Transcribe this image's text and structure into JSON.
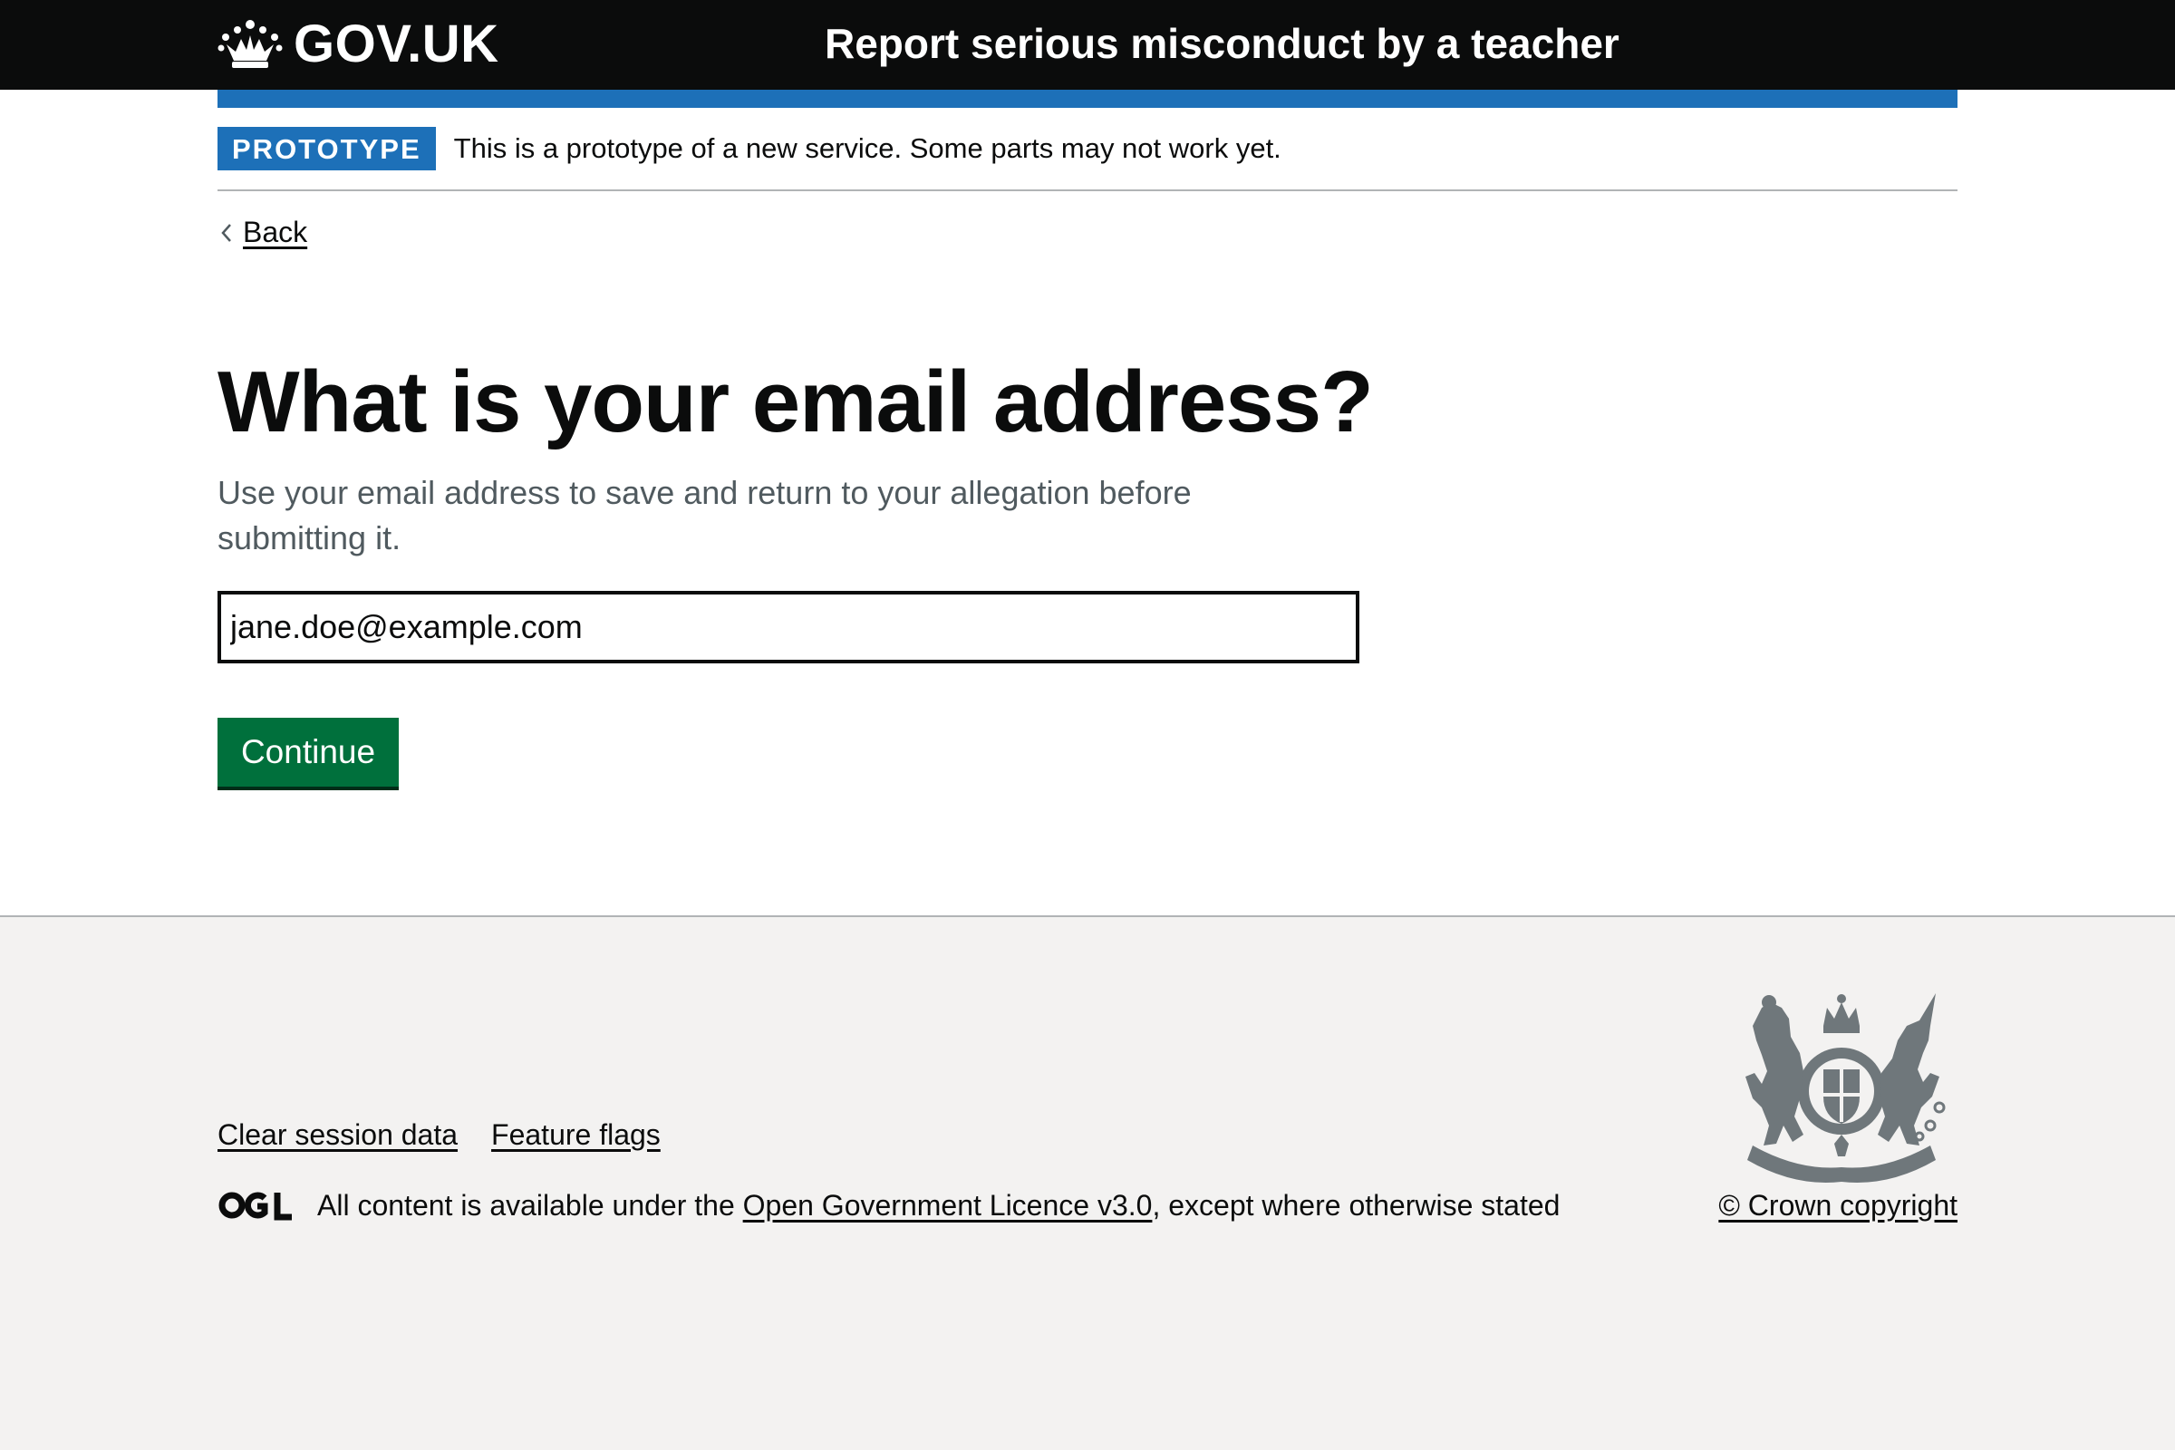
{
  "header": {
    "logo_text": "GOV.UK",
    "service_name": "Report serious misconduct by a teacher"
  },
  "phase_banner": {
    "tag": "PROTOTYPE",
    "text": "This is a prototype of a new service. Some parts may not work yet."
  },
  "back_link": "Back",
  "question": {
    "heading": "What is your email address?",
    "hint": "Use your email address to save and return to your allegation before submitting it.",
    "email_value": "jane.doe@example.com"
  },
  "continue_label": "Continue",
  "footer": {
    "links": [
      {
        "label": "Clear session data"
      },
      {
        "label": "Feature flags"
      }
    ],
    "licence_prefix": "All content is available under the ",
    "licence_link": "Open Government Licence v3.0",
    "licence_suffix": ", except where otherwise stated",
    "copyright": "© Crown copyright"
  },
  "colors": {
    "header_bg": "#0b0c0c",
    "brand_blue": "#1d70b8",
    "button_green": "#00703c",
    "footer_bg": "#f3f2f1",
    "hint_grey": "#505a5f"
  }
}
